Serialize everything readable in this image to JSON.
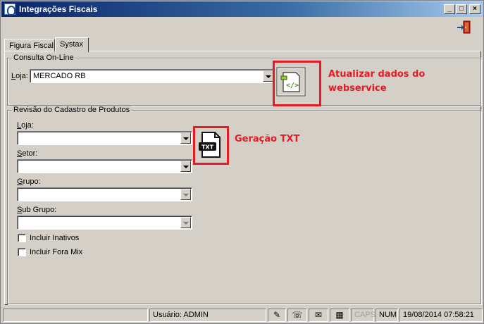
{
  "window": {
    "title": "Integrações Fiscais"
  },
  "tabs": [
    {
      "label": "Figura Fiscal"
    },
    {
      "label": "Systax"
    }
  ],
  "consulta": {
    "legend": "Consulta On-Line",
    "loja_label": "Loja:",
    "loja_value": "MERCADO RB"
  },
  "revisao": {
    "legend": "Revisão do Cadastro de Produtos",
    "loja_label": "Loja:",
    "setor_label": "Setor:",
    "grupo_label": "Grupo:",
    "subgrupo_label": "Sub Grupo:",
    "incluir_inativos": "Incluir Inativos",
    "incluir_fora_mix": "Incluir Fora Mix"
  },
  "annotations": {
    "webservice_line1": "Atualizar dados do",
    "webservice_line2": "webservice",
    "txt": "Geração TXT"
  },
  "buttons": {
    "txt_icon_text": "TXT"
  },
  "statusbar": {
    "usuario": "Usuário: ADMIN",
    "caps": "CAPS",
    "num": "NUM",
    "datetime": "19/08/2014 07:58:21"
  },
  "colors": {
    "annotation": "#e31b23",
    "title_bar_start": "#0a246a",
    "face": "#d4d0c8"
  },
  "icons": {
    "exit": "exit-door-icon",
    "webservice": "webservice-code-icon",
    "txt": "txt-file-icon",
    "status": [
      "edit-icon",
      "phone-icon",
      "mail-icon",
      "calculator-icon"
    ]
  }
}
